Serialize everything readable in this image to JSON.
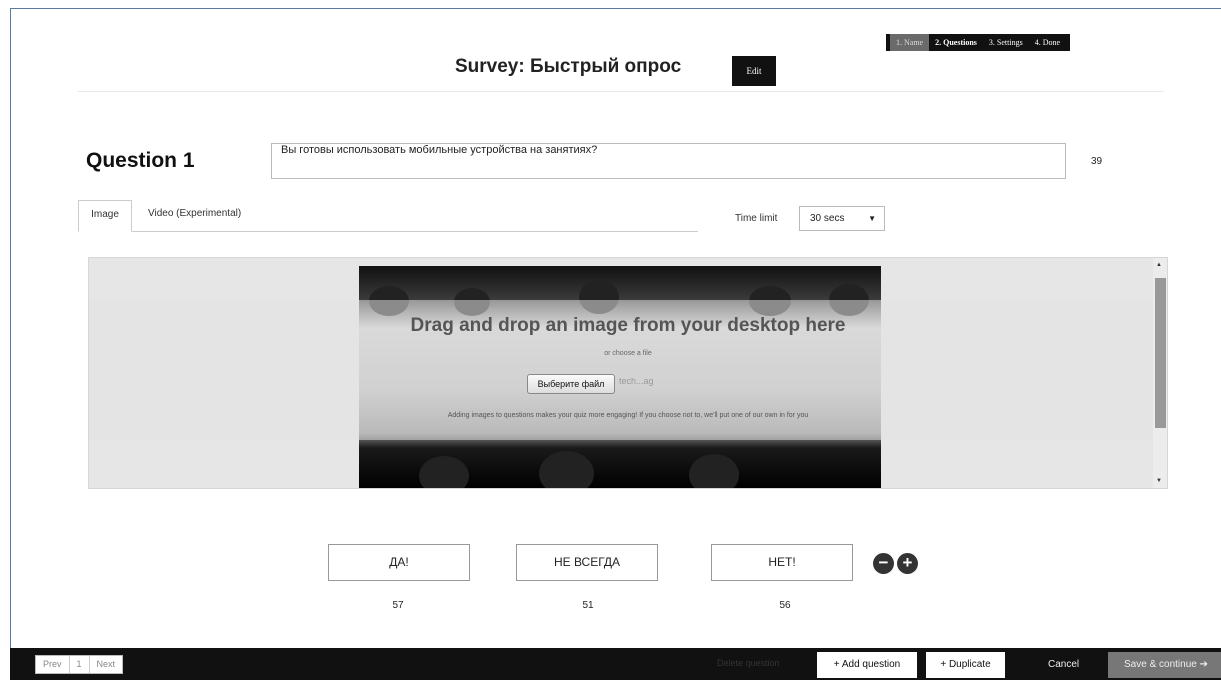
{
  "steps": [
    "1. Name",
    "2. Questions",
    "3. Settings",
    "4. Done"
  ],
  "survey": {
    "title": "Survey: Быстрый опрос",
    "edit_label": "Edit"
  },
  "question": {
    "label": "Question 1",
    "text": "Вы готовы использовать мобильные устройства на занятиях?",
    "remaining_chars": "39"
  },
  "media_tabs": [
    "Image",
    "Video (Experimental)"
  ],
  "time_limit": {
    "label": "Time limit",
    "value": "30 secs"
  },
  "dropzone": {
    "heading": "Drag and drop an image from your desktop here",
    "or_text": "or choose a file",
    "file_button": "Выберите файл",
    "file_name": "tech...ag",
    "hint": "Adding images to questions makes your quiz more engaging! If you choose not to, we'll put one of our own in for you"
  },
  "answers": [
    {
      "text": "ДА!",
      "count": "57"
    },
    {
      "text": "НЕ ВСЕГДА",
      "count": "51"
    },
    {
      "text": "НЕТ!",
      "count": "56"
    }
  ],
  "pager": {
    "prev": "Prev",
    "page": "1",
    "next": "Next"
  },
  "actions": {
    "delete": "Delete question",
    "add": "+ Add question",
    "duplicate": "+ Duplicate",
    "cancel": "Cancel",
    "save": "Save & continue ➔"
  }
}
